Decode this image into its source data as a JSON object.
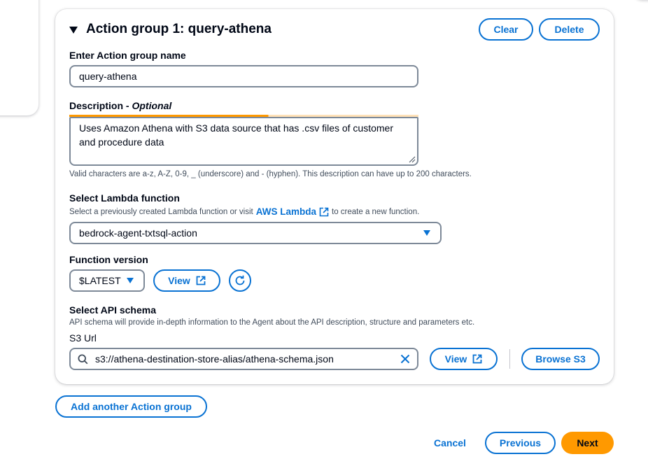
{
  "action_group": {
    "title": "Action group 1: query-athena",
    "clear_label": "Clear",
    "delete_label": "Delete",
    "name_label": "Enter Action group name",
    "name_value": "query-athena",
    "description_label": "Description - ",
    "description_optional": "Optional",
    "description_value": "Uses Amazon Athena with S3 data source that has .csv files of customer and procedure data",
    "description_hint": "Valid characters are a-z, A-Z, 0-9, _ (underscore) and - (hyphen). This description can have up to 200 characters.",
    "lambda_label": "Select Lambda function",
    "lambda_hint_prefix": "Select a previously created Lambda function or visit",
    "lambda_hint_link": "AWS Lambda",
    "lambda_hint_suffix": "to create a new function.",
    "lambda_value": "bedrock-agent-txtsql-action",
    "version_label": "Function version",
    "version_value": "$LATEST",
    "version_view_label": "View",
    "schema_label": "Select API schema",
    "schema_hint": "API schema will provide in-depth information to the Agent about the API description, structure and parameters etc.",
    "s3_url_label": "S3 Url",
    "s3_url_value": "s3://athena-destination-store-alias/athena-schema.json",
    "schema_view_label": "View",
    "browse_s3_label": "Browse S3"
  },
  "add_group_label": "Add another Action group",
  "footer": {
    "cancel_label": "Cancel",
    "previous_label": "Previous",
    "next_label": "Next"
  },
  "colors": {
    "primary": "#0972d3",
    "accent": "#ff9900",
    "text": "#000716",
    "border": "#7d8998"
  }
}
